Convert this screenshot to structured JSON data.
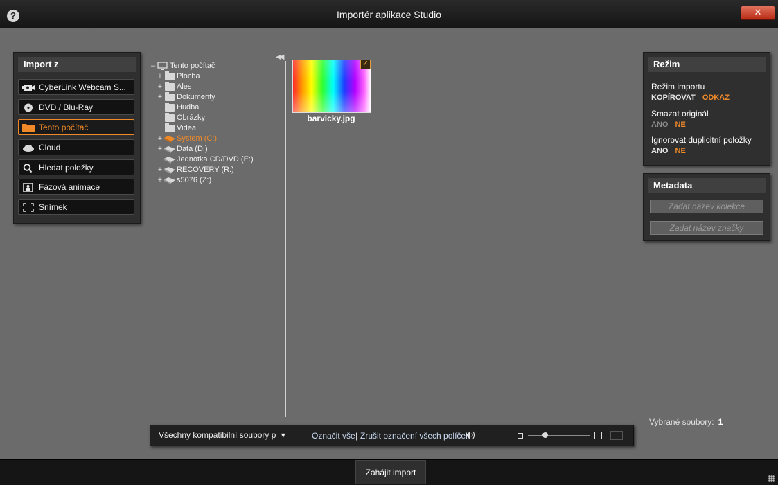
{
  "window": {
    "title": "Importér aplikace Studio",
    "help_icon": "?",
    "close_icon": "✕"
  },
  "import_from": {
    "header": "Import z",
    "items": [
      {
        "label": "CyberLink Webcam S...",
        "icon": "webcam-icon",
        "active": false
      },
      {
        "label": "DVD / Blu-Ray",
        "icon": "disc-icon",
        "active": false
      },
      {
        "label": "Tento počítač",
        "icon": "folder-icon",
        "active": true
      },
      {
        "label": "Cloud",
        "icon": "cloud-icon",
        "active": false
      },
      {
        "label": "Hledat položky",
        "icon": "magnifier-icon",
        "active": false
      },
      {
        "label": "Fázová animace",
        "icon": "stop-motion-icon",
        "active": false
      },
      {
        "label": "Snímek",
        "icon": "snapshot-icon",
        "active": false
      }
    ]
  },
  "tree": {
    "root": {
      "label": "Tento počítač",
      "expander": "–"
    },
    "items": [
      {
        "label": "Plocha",
        "expander": "+",
        "icon": "folder-icon"
      },
      {
        "label": "Ales",
        "expander": "+",
        "icon": "folder-icon"
      },
      {
        "label": "Dokumenty",
        "expander": "+",
        "icon": "folder-icon"
      },
      {
        "label": "Hudba",
        "expander": "",
        "icon": "folder-icon"
      },
      {
        "label": "Obrázky",
        "expander": "",
        "icon": "folder-icon"
      },
      {
        "label": "Videa",
        "expander": "",
        "icon": "folder-icon"
      },
      {
        "label": "System (C:)",
        "expander": "+",
        "icon": "drive-icon",
        "active": true
      },
      {
        "label": "Data (D:)",
        "expander": "+",
        "icon": "drive-icon"
      },
      {
        "label": "Jednotka CD/DVD (E:)",
        "expander": "",
        "icon": "drive-icon"
      },
      {
        "label": "RECOVERY (R:)",
        "expander": "+",
        "icon": "drive-icon"
      },
      {
        "label": "s5076 (Z:)",
        "expander": "+",
        "icon": "drive-icon"
      }
    ],
    "collapse_icon": "◀◀"
  },
  "files": [
    {
      "name": "barvicky.jpg",
      "checked": true,
      "check_glyph": "✓"
    }
  ],
  "mode": {
    "header": "Režim",
    "import_mode": {
      "label": "Režim importu",
      "options": [
        {
          "text": "KOPÍROVAT",
          "selected": false
        },
        {
          "text": "ODKAZ",
          "selected": true
        }
      ]
    },
    "delete_original": {
      "label": "Smazat originál",
      "options": [
        {
          "text": "ANO",
          "selected": false
        },
        {
          "text": "NE",
          "selected": true
        }
      ]
    },
    "ignore_duplicates": {
      "label": "Ignorovat duplicitní položky",
      "options": [
        {
          "text": "ANO",
          "selected": false
        },
        {
          "text": "NE",
          "selected": true
        }
      ]
    }
  },
  "metadata": {
    "header": "Metadata",
    "collection_placeholder": "Zadat název kolekce",
    "tag_placeholder": "Zadat název značky"
  },
  "bottom_bar": {
    "filter_label": "Všechny kompatibilní soubory p",
    "filter_arrow": "▾",
    "select_all": "Označit vše",
    "separator": "|",
    "deselect_all": "Zrušit označení všech políček"
  },
  "selected_files": {
    "label": "Vybrané soubory:",
    "count": "1"
  },
  "footer": {
    "start_button": "Zahájit import"
  },
  "colors": {
    "accent": "#f08a28",
    "background": "#6b6b6b",
    "panel": "#2f2f2f"
  }
}
